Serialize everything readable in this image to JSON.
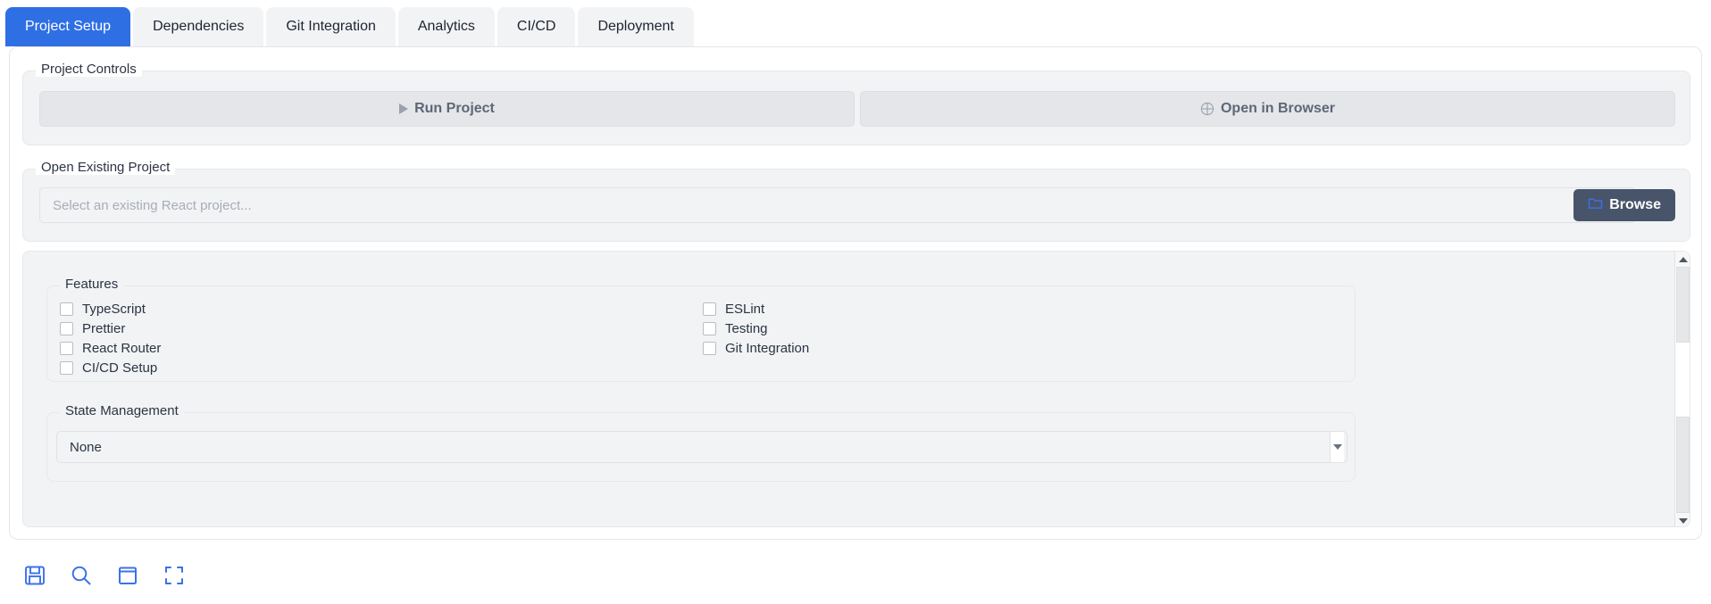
{
  "tabs": [
    {
      "label": "Project Setup",
      "active": true
    },
    {
      "label": "Dependencies",
      "active": false
    },
    {
      "label": "Git Integration",
      "active": false
    },
    {
      "label": "Analytics",
      "active": false
    },
    {
      "label": "CI/CD",
      "active": false
    },
    {
      "label": "Deployment",
      "active": false
    }
  ],
  "project_controls": {
    "legend": "Project Controls",
    "run_button": {
      "label": "Run Project",
      "icon": "play-icon"
    },
    "open_browser_button": {
      "label": "Open in Browser",
      "icon": "globe-icon"
    }
  },
  "open_existing": {
    "legend": "Open Existing Project",
    "path_input": {
      "value": "",
      "placeholder": "Select an existing React project..."
    },
    "browse_button": {
      "label": "Browse",
      "icon": "folder-icon"
    }
  },
  "features": {
    "legend": "Features",
    "left_column": [
      {
        "label": "TypeScript",
        "checked": false
      },
      {
        "label": "Prettier",
        "checked": false
      },
      {
        "label": "React Router",
        "checked": false
      },
      {
        "label": "CI/CD Setup",
        "checked": false
      }
    ],
    "right_column": [
      {
        "label": "ESLint",
        "checked": false
      },
      {
        "label": "Testing",
        "checked": false
      },
      {
        "label": "Git Integration",
        "checked": false
      }
    ]
  },
  "state_management": {
    "legend": "State Management",
    "selected": "None",
    "options": [
      "None"
    ]
  },
  "toolbar": {
    "icons": [
      {
        "name": "save-icon"
      },
      {
        "name": "search-icon"
      },
      {
        "name": "window-icon"
      },
      {
        "name": "fullscreen-icon"
      }
    ]
  },
  "colors": {
    "accent_blue": "#2f6fe4",
    "icon_blue": "#3b72e8",
    "browse_dark": "#48546a",
    "panel_gray": "#f1f3f5",
    "text_dark": "#2b3442"
  }
}
